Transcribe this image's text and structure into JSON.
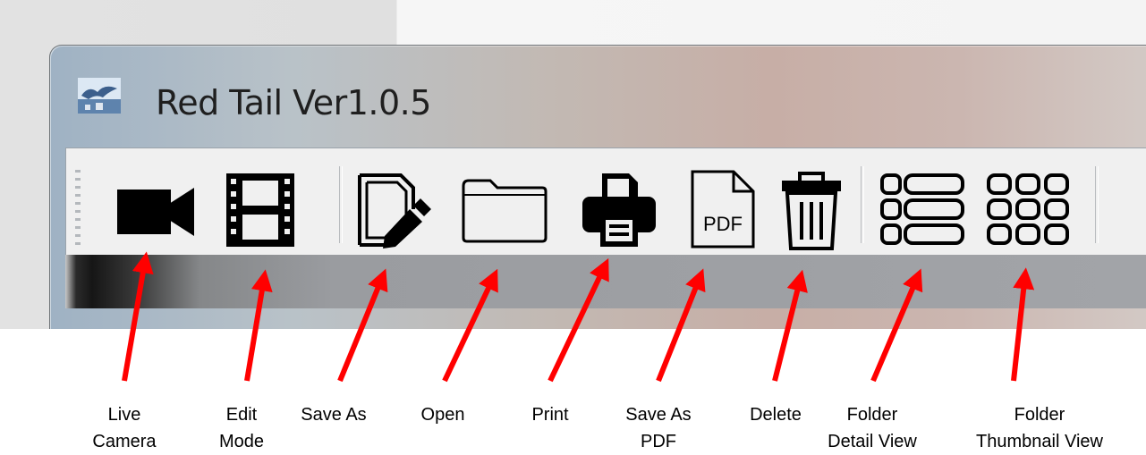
{
  "window": {
    "title": "Red Tail Ver1.0.5",
    "app_icon": "red-tail-hawk-logo-icon"
  },
  "toolbar": {
    "buttons": [
      {
        "id": "live-camera",
        "icon": "video-camera-icon"
      },
      {
        "id": "edit-mode",
        "icon": "film-strip-icon"
      },
      {
        "id": "save-as",
        "icon": "document-edit-icon"
      },
      {
        "id": "open",
        "icon": "folder-icon"
      },
      {
        "id": "print",
        "icon": "printer-icon"
      },
      {
        "id": "save-as-pdf",
        "icon": "pdf-document-icon"
      },
      {
        "id": "delete",
        "icon": "trash-can-icon"
      },
      {
        "id": "folder-detail-view",
        "icon": "list-view-icon"
      },
      {
        "id": "folder-thumbnail-view",
        "icon": "grid-view-icon"
      }
    ]
  },
  "annotations": {
    "arrow_color": "#ff0000",
    "labels": [
      {
        "text": "Live\nCamera"
      },
      {
        "text": "Edit\nMode"
      },
      {
        "text": "Save As"
      },
      {
        "text": "Open"
      },
      {
        "text": "Print"
      },
      {
        "text": "Save As\nPDF"
      },
      {
        "text": "Delete"
      },
      {
        "text": "Folder\nDetail View"
      },
      {
        "text": "Folder\nThumbnail View"
      }
    ]
  }
}
